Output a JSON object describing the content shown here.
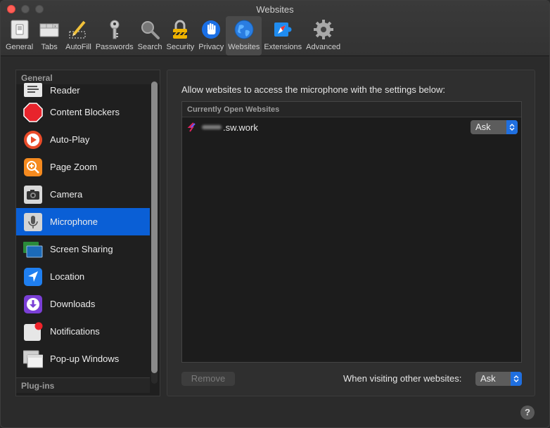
{
  "window": {
    "title": "Websites"
  },
  "toolbar": [
    {
      "label": "General",
      "icon": "general-switch-icon"
    },
    {
      "label": "Tabs",
      "icon": "tabs-icon"
    },
    {
      "label": "AutoFill",
      "icon": "autofill-pencil-icon"
    },
    {
      "label": "Passwords",
      "icon": "key-icon"
    },
    {
      "label": "Search",
      "icon": "magnifier-icon"
    },
    {
      "label": "Security",
      "icon": "padlock-icon"
    },
    {
      "label": "Privacy",
      "icon": "hand-icon"
    },
    {
      "label": "Websites",
      "icon": "globe-icon"
    },
    {
      "label": "Extensions",
      "icon": "puzzle-icon"
    },
    {
      "label": "Advanced",
      "icon": "gear-icon"
    }
  ],
  "sidebar": {
    "general_header": "General",
    "plugins_header": "Plug-ins",
    "items": [
      {
        "label": "Reader",
        "icon": "reader-icon"
      },
      {
        "label": "Content Blockers",
        "icon": "stop-sign-icon"
      },
      {
        "label": "Auto-Play",
        "icon": "play-icon"
      },
      {
        "label": "Page Zoom",
        "icon": "zoom-icon"
      },
      {
        "label": "Camera",
        "icon": "camera-icon"
      },
      {
        "label": "Microphone",
        "icon": "microphone-icon"
      },
      {
        "label": "Screen Sharing",
        "icon": "screen-sharing-icon"
      },
      {
        "label": "Location",
        "icon": "location-arrow-icon"
      },
      {
        "label": "Downloads",
        "icon": "downloads-icon"
      },
      {
        "label": "Notifications",
        "icon": "notifications-icon"
      },
      {
        "label": "Pop-up Windows",
        "icon": "popup-windows-icon"
      }
    ],
    "selected": "Microphone"
  },
  "main": {
    "description": "Allow websites to access the microphone with the settings below:",
    "table_header": "Currently Open Websites",
    "sites": [
      {
        "domain": ".sw.work",
        "setting": "Ask"
      }
    ],
    "remove_label": "Remove",
    "other_label": "When visiting other websites:",
    "other_setting": "Ask"
  },
  "help_label": "?",
  "colors": {
    "accent": "#0a5fd6",
    "select_arrow": "#1f6fe0"
  }
}
